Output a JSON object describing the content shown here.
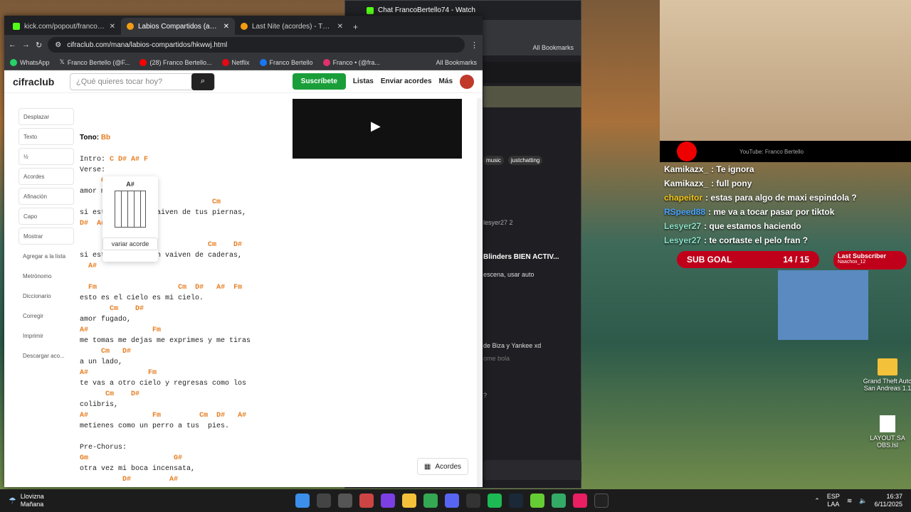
{
  "desktop": {
    "icons": [
      {
        "label": "Grand Theft Auto San Andreas 1.1"
      },
      {
        "label": "LAYOUT SA OBS.lsl"
      }
    ]
  },
  "back_window": {
    "tab_title": "Chat FrancoBertello74 - Watch",
    "bookmarks_label": "All Bookmarks",
    "tags": [
      "music",
      "justchatting"
    ],
    "user": "lesyer27",
    "user_count": "2",
    "title": "Blinders BIEN ACTIV...",
    "line1": "escena, usar auto",
    "line2": "de Biza y Yankee xd",
    "line3": "ome bola",
    "line4": "?"
  },
  "stream": {
    "youtube_label": "YouTube: Franco Bertello",
    "chat": [
      {
        "user": "Kamikazx_",
        "msg": ": Te ignora",
        "color": "#ffffff"
      },
      {
        "user": "Kamikazx_",
        "msg": ": full pony",
        "color": "#ffffff"
      },
      {
        "user": "chapeitor",
        "msg": ": estas para algo de maxi espindola ?",
        "color": "#f5c518"
      },
      {
        "user": "RSpeed88",
        "msg": ": me va a tocar pasar por tiktok",
        "color": "#4aa3ff"
      },
      {
        "user": "Lesyer27",
        "msg": ": que estamos haciendo",
        "color": "#8be0c8"
      },
      {
        "user": "Lesyer27",
        "msg": ": te cortaste el pelo fran ?",
        "color": "#8be0c8"
      }
    ],
    "sub_goal_label": "SUB GOAL",
    "sub_goal_value": "14 / 15",
    "sub_goal_fraction": 0.933,
    "last_sub_label": "Last Subscriber",
    "last_sub_name": "Naachox_12"
  },
  "browser": {
    "tabs": [
      {
        "title": "kick.com/popout/francobertello",
        "active": false
      },
      {
        "title": "Labios Compartidos (acordes) -",
        "active": true
      },
      {
        "title": "Last Nite (acordes) - The Strokes",
        "active": false
      }
    ],
    "url": "cifraclub.com/mana/labios-compartidos/hkwwj.html",
    "bookmarks": [
      "WhatsApp",
      "Franco Bertello (@F...",
      "(28) Franco Bertello...",
      "Netflix",
      "Franco Bertello",
      "Franco • (@fra..."
    ],
    "all_bookmarks": "All Bookmarks",
    "site": {
      "logo": "cifraclub",
      "search_placeholder": "¿Qué quieres tocar hoy?",
      "subscribe": "Suscríbete",
      "nav": [
        "Listas",
        "Enviar acordes",
        "Más"
      ],
      "sidebar": [
        "Desplazar",
        "Texto",
        "½",
        "Acordes",
        "Afinación",
        "Capo",
        "Mostrar",
        "Agregar a la lista",
        "Metrónomo",
        "Diccionario",
        "Corregir",
        "Imprimir",
        "Descargar aco..."
      ],
      "tono_label": "Tono:",
      "tono_value": "Bb",
      "popup_chord": "A#",
      "popup_action": "variar acorde",
      "acordes_button": "Acordes"
    }
  },
  "taskbar": {
    "weather_line1": "Llovizna",
    "weather_line2": "Mañana",
    "lang": "ESP",
    "lang2": "LAA",
    "time": "16:37",
    "date": "6/11/2025"
  }
}
